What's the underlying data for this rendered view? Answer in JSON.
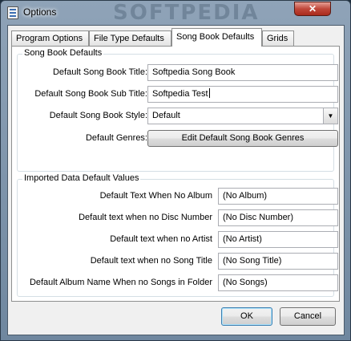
{
  "window": {
    "title": "Options",
    "watermark": "SOFTPEDIA",
    "close_glyph": "✕"
  },
  "tabs": [
    {
      "label": "Program Options",
      "active": false
    },
    {
      "label": "File Type Defaults",
      "active": false
    },
    {
      "label": "Song Book Defaults",
      "active": true
    },
    {
      "label": "Grids",
      "active": false
    }
  ],
  "song_book_defaults": {
    "group_title": "Song Book Defaults",
    "title_label": "Default Song Book Title:",
    "title_value": "Softpedia Song Book",
    "subtitle_label": "Default Song Book Sub Title:",
    "subtitle_value": "Softpedia Test",
    "style_label": "Default Song Book Style:",
    "style_value": "Default",
    "style_arrow": "▼",
    "genres_label": "Default Genres:",
    "genres_button": "Edit Default Song Book Genres"
  },
  "imported_defaults": {
    "group_title": "Imported Data Default Values",
    "rows": [
      {
        "label": "Default Text When No Album",
        "value": "(No Album)"
      },
      {
        "label": "Default text when no Disc Number",
        "value": "(No Disc Number)"
      },
      {
        "label": "Default text when no Artist",
        "value": "(No Artist)"
      },
      {
        "label": "Default text when no Song Title",
        "value": "(No Song Title)"
      },
      {
        "label": "Default Album Name When no Songs in Folder",
        "value": "(No Songs)"
      }
    ]
  },
  "footer": {
    "ok_label": "OK",
    "cancel_label": "Cancel"
  }
}
